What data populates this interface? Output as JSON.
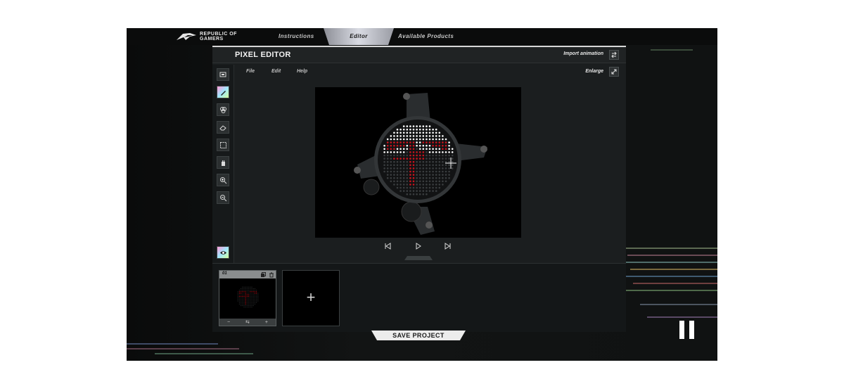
{
  "nav": {
    "logo_text_line1": "REPUBLIC OF",
    "logo_text_line2": "GAMERS",
    "tabs": [
      {
        "label": "Instructions"
      },
      {
        "label": "Editor"
      },
      {
        "label": "Available Products"
      }
    ]
  },
  "editor": {
    "title": "PIXEL EDITOR",
    "import_label": "Import animation",
    "enlarge_label": "Enlarge",
    "menu": [
      "File",
      "Edit",
      "Help"
    ],
    "tools": [
      {
        "icon": "layer-icon"
      },
      {
        "icon": "pencil-icon"
      },
      {
        "icon": "color-fill-icon"
      },
      {
        "icon": "eraser-icon"
      },
      {
        "icon": "select-area-icon"
      },
      {
        "icon": "hand-icon"
      },
      {
        "icon": "zoom-in-icon"
      },
      {
        "icon": "zoom-out-icon"
      },
      {
        "icon": "eye-icon"
      }
    ]
  },
  "frames": {
    "items": [
      {
        "number": "01"
      }
    ],
    "add_label": "+",
    "frame_foot": [
      "−",
      "⇆",
      "+"
    ]
  },
  "save_label": "SAVE PROJECT",
  "colors": {
    "accent_red": "#c8141e",
    "pixel_white": "#ffffff",
    "panel": "#1b1e1f"
  }
}
